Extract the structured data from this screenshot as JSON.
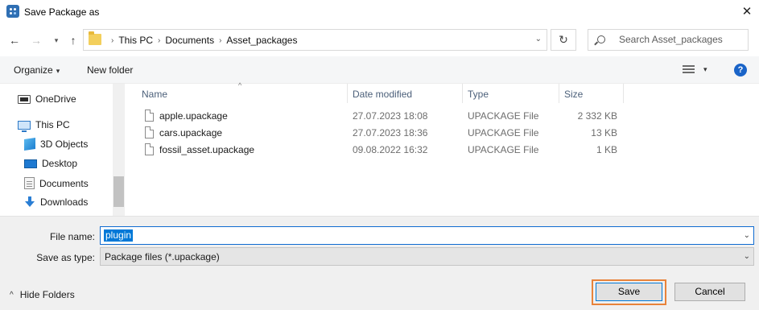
{
  "window": {
    "title": "Save Package as",
    "close_glyph": "✕",
    "app_icon": "unity-app-icon"
  },
  "navigation": {
    "back_glyph": "←",
    "forward_glyph": "→",
    "recent_glyph": "▾",
    "up_glyph": "↑",
    "refresh_glyph": "↻"
  },
  "address": {
    "breadcrumbs": [
      "This PC",
      "Documents",
      "Asset_packages"
    ],
    "separator": "›",
    "dropdown_glyph": "⌄"
  },
  "search": {
    "placeholder": "Search Asset_packages"
  },
  "toolbar": {
    "organize_label": "Organize",
    "organize_caret": "▾",
    "new_folder_label": "New folder",
    "view_caret": "▾",
    "help_label": "?"
  },
  "sidebar": {
    "items": [
      {
        "label": "OneDrive",
        "icon": "onedrive-icon"
      },
      {
        "label": "This PC",
        "icon": "this-pc-icon"
      },
      {
        "label": "3D Objects",
        "icon": "3d-objects-icon"
      },
      {
        "label": "Desktop",
        "icon": "desktop-icon"
      },
      {
        "label": "Documents",
        "icon": "documents-icon"
      },
      {
        "label": "Downloads",
        "icon": "downloads-icon"
      }
    ]
  },
  "file_list": {
    "columns": {
      "name": "Name",
      "date": "Date modified",
      "type": "Type",
      "size": "Size"
    },
    "sort_glyph": "^",
    "rows": [
      {
        "name": "apple.upackage",
        "date": "27.07.2023 18:08",
        "type": "UPACKAGE File",
        "size": "2 332 KB"
      },
      {
        "name": "cars.upackage",
        "date": "27.07.2023 18:36",
        "type": "UPACKAGE File",
        "size": "13 KB"
      },
      {
        "name": "fossil_asset.upackage",
        "date": "09.08.2022 16:32",
        "type": "UPACKAGE File",
        "size": "1 KB"
      }
    ]
  },
  "form": {
    "file_name_label": "File name:",
    "file_name_value": "plugin",
    "save_as_type_label": "Save as type:",
    "save_as_type_value": "Package files (*.upackage)",
    "dropdown_glyph": "⌄"
  },
  "footer": {
    "hide_folders_label": "Hide Folders",
    "hide_caret": "^",
    "save_label": "Save",
    "cancel_label": "Cancel"
  },
  "colors": {
    "accent": "#0078d7",
    "save_highlight": "#e8833a",
    "help": "#1a64c8"
  }
}
